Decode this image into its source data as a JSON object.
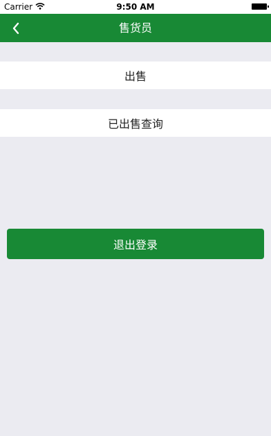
{
  "status_bar": {
    "carrier": "Carrier",
    "time": "9:50 AM"
  },
  "nav": {
    "title": "售货员"
  },
  "menu": {
    "items": [
      {
        "label": "出售"
      },
      {
        "label": "已出售查询"
      }
    ]
  },
  "logout": {
    "label": "退出登录"
  },
  "colors": {
    "brand": "#188935",
    "background": "#ebebf1"
  }
}
